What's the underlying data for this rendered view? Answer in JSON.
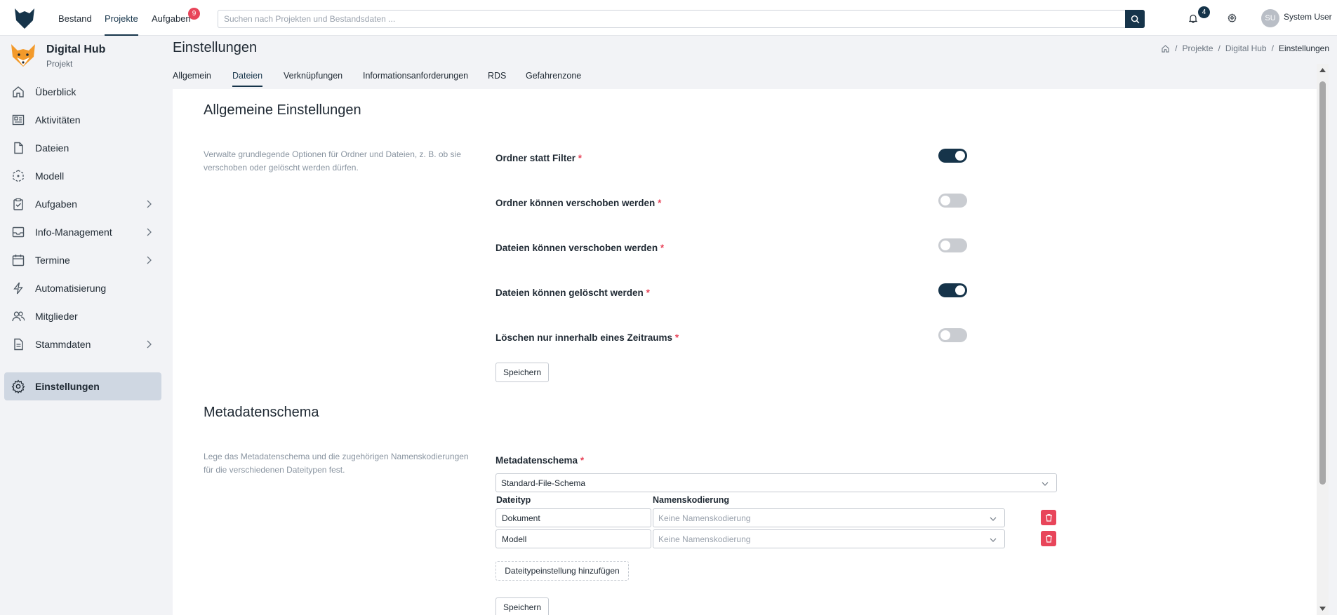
{
  "topnav": {
    "items": [
      {
        "label": "Bestand"
      },
      {
        "label": "Projekte"
      },
      {
        "label": "Aufgaben"
      }
    ],
    "tasks_badge": "9",
    "notifications_badge": "4",
    "search_placeholder": "Suchen nach Projekten und Bestandsdaten ...",
    "user_initials": "SU",
    "user_name": "System User"
  },
  "project": {
    "name": "Digital Hub",
    "type": "Projekt"
  },
  "sidebar": {
    "items": [
      {
        "label": "Überblick",
        "icon": "home-icon"
      },
      {
        "label": "Aktivitäten",
        "icon": "newspaper-icon"
      },
      {
        "label": "Dateien",
        "icon": "file-icon"
      },
      {
        "label": "Modell",
        "icon": "cube-icon"
      },
      {
        "label": "Aufgaben",
        "icon": "clipboard-check-icon"
      },
      {
        "label": "Info-Management",
        "icon": "inbox-icon"
      },
      {
        "label": "Termine",
        "icon": "calendar-icon"
      },
      {
        "label": "Automatisierung",
        "icon": "bolt-icon"
      },
      {
        "label": "Mitglieder",
        "icon": "users-icon"
      },
      {
        "label": "Stammdaten",
        "icon": "document-icon"
      },
      {
        "label": "Einstellungen",
        "icon": "gear-icon"
      }
    ]
  },
  "page": {
    "title": "Einstellungen",
    "breadcrumb": [
      "Projekte",
      "Digital Hub",
      "Einstellungen"
    ],
    "tabs": [
      "Allgemein",
      "Dateien",
      "Verknüpfungen",
      "Informationsanforderungen",
      "RDS",
      "Gefahrenzone"
    ],
    "active_tab": "Dateien"
  },
  "general": {
    "title": "Allgemeine Einstellungen",
    "description": "Verwalte grundlegende Optionen für Ordner und Dateien, z. B. ob sie verschoben oder gelöscht werden dürfen.",
    "settings": [
      {
        "label": "Ordner statt Filter",
        "enabled": true
      },
      {
        "label": "Ordner können verschoben werden",
        "enabled": false
      },
      {
        "label": "Dateien können verschoben werden",
        "enabled": false
      },
      {
        "label": "Dateien können gelöscht werden",
        "enabled": true
      },
      {
        "label": "Löschen nur innerhalb eines Zeitraums",
        "enabled": false
      }
    ],
    "required_mark": "*",
    "save_label": "Speichern"
  },
  "metadata": {
    "title": "Metadatenschema",
    "description": "Lege das Metadatenschema und die zugehörigen Namenskodierungen für die verschiedenen Dateitypen fest.",
    "schema_label": "Metadatenschema",
    "schema_value": "Standard-File-Schema",
    "col_filetype": "Dateityp",
    "col_naming": "Namenskodierung",
    "rows": [
      {
        "filetype": "Dokument",
        "naming_placeholder": "Keine Namenskodierung"
      },
      {
        "filetype": "Modell",
        "naming_placeholder": "Keine Namenskodierung"
      }
    ],
    "add_label": "Dateitypeinstellung hinzufügen",
    "save_label": "Speichern"
  },
  "colors": {
    "primary": "#16344a",
    "danger": "#e8455a",
    "active_nav": "#cfd7e2"
  }
}
